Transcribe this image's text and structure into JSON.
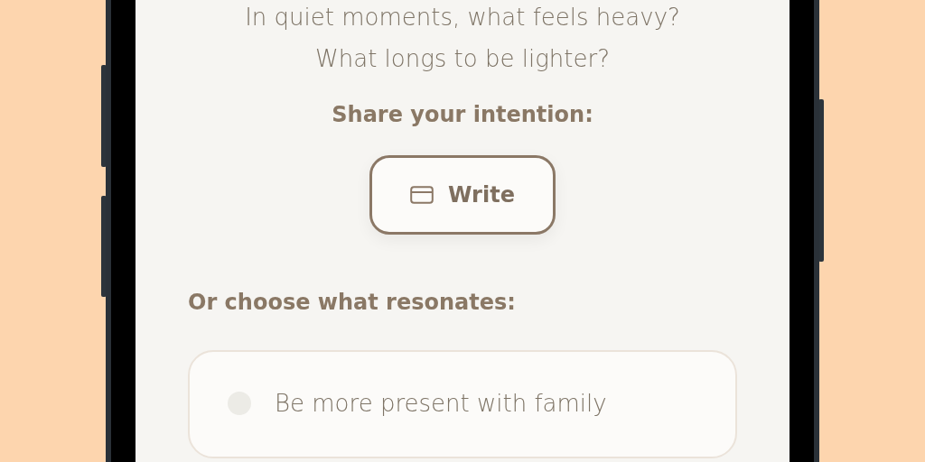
{
  "prompt": [
    "In quiet moments, what feels heavy?",
    "What longs to be lighter?"
  ],
  "share_label": "Share your intention:",
  "write_button": {
    "label": "Write"
  },
  "choose_label": "Or choose what resonates:",
  "options": [
    {
      "label": "Be more present with family",
      "selected": false
    }
  ]
}
